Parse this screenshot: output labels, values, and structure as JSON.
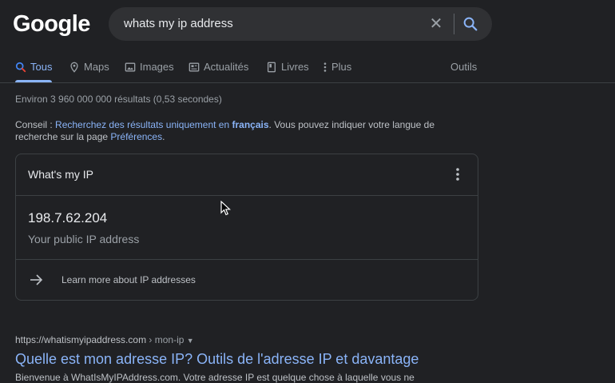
{
  "logo": "Google",
  "search": {
    "query": "whats my ip address",
    "clear_icon": "close-icon",
    "search_icon": "search-icon"
  },
  "tabs": [
    {
      "label": "Tous",
      "icon": "search-icon",
      "active": true
    },
    {
      "label": "Maps",
      "icon": "map-pin-icon"
    },
    {
      "label": "Images",
      "icon": "image-icon"
    },
    {
      "label": "Actualités",
      "icon": "news-icon"
    },
    {
      "label": "Livres",
      "icon": "book-icon"
    },
    {
      "label": "Plus",
      "icon": "more-vert-icon"
    }
  ],
  "tools_label": "Outils",
  "result_stats": "Environ 3 960 000 000 résultats (0,53 secondes)",
  "tip": {
    "prefix": "Conseil : ",
    "link": "Recherchez des résultats uniquement en",
    "language": "français",
    "middle": ". Vous pouvez indiquer votre langue de recherche sur la page ",
    "prefs_link": "Préférences",
    "suffix": "."
  },
  "ip_card": {
    "title": "What's my IP",
    "ip": "198.7.62.204",
    "ip_label": "Your public IP address",
    "learn_more": "Learn more about IP addresses"
  },
  "result": {
    "url": "https://whatismyipaddress.com",
    "path": " › mon-ip",
    "title": "Quelle est mon adresse IP? Outils de l'adresse IP et davantage",
    "snippet": "Bienvenue à WhatIsMyIPAddress.com. Votre adresse IP est quelque chose à laquelle vous ne"
  },
  "colors": {
    "background": "#202124",
    "link": "#8ab4f8",
    "text": "#bdc1c6"
  }
}
